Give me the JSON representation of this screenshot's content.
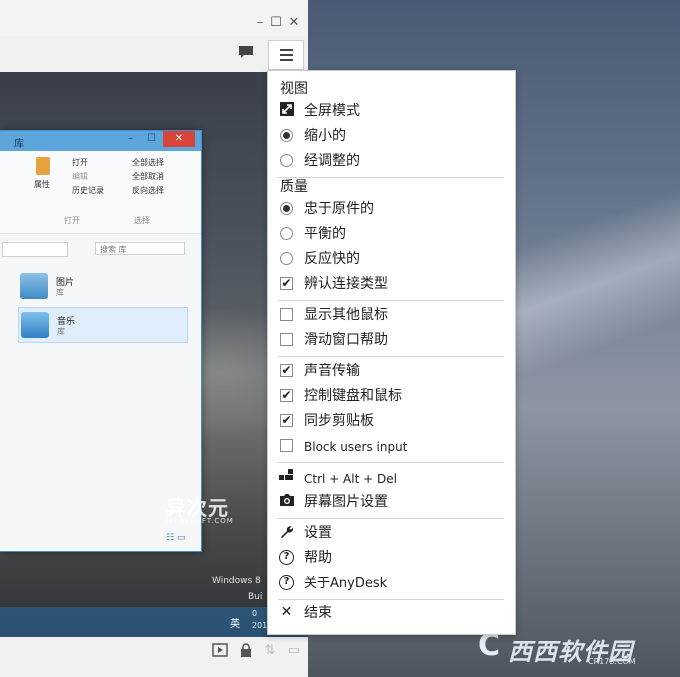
{
  "window": {
    "controls": [
      "–",
      "☐",
      "✕"
    ],
    "toolbar_icons": [
      "chat-icon"
    ]
  },
  "remote_desktop": {
    "explorer": {
      "title": "库",
      "ribbon": {
        "open": "打开",
        "edit": "编辑",
        "history": "历史记录",
        "properties": "属性",
        "select_all": "全部选择",
        "select_none": "全部取消",
        "invert_selection": "反向选择",
        "group_open": "打开",
        "group_select": "选择"
      },
      "search_placeholder": "搜索 库",
      "items": [
        {
          "name": "图片",
          "sub": "库"
        },
        {
          "name": "音乐",
          "sub": "库"
        }
      ]
    },
    "watermark": "异次元",
    "watermark_sub": "IPLAYSOFT.COM",
    "windows_text": "Windows 8",
    "build_text": "Bui",
    "taskbar": {
      "ime": "英",
      "time": "0",
      "date": "201"
    }
  },
  "menu": {
    "view_header": "视图",
    "view_items": [
      {
        "label": "全屏模式",
        "icon": "fullscreen-icon"
      },
      {
        "label": "缩小的",
        "selected": true
      },
      {
        "label": "经调整的",
        "selected": false
      }
    ],
    "quality_header": "质量",
    "quality_items": [
      {
        "label": "忠于原件的",
        "selected": true
      },
      {
        "label": "平衡的",
        "selected": false
      },
      {
        "label": "反应快的",
        "selected": false
      }
    ],
    "detect_connection": {
      "label": "辨认连接类型",
      "checked": true
    },
    "show_remote_cursor": {
      "label": "显示其他鼠标",
      "checked": false
    },
    "scroll_window_help": {
      "label": "滑动窗口帮助",
      "checked": false
    },
    "transmit_audio": {
      "label": "声音传输",
      "checked": true
    },
    "control_input": {
      "label": "控制键盘和鼠标",
      "checked": true
    },
    "sync_clipboard": {
      "label": "同步剪贴板",
      "checked": true
    },
    "block_input": {
      "label": "Block users input",
      "checked": false
    },
    "ctrl_alt_del": "Ctrl + Alt + Del",
    "screenshot_settings": "屏幕图片设置",
    "settings": "设置",
    "help": "帮助",
    "about": "关于AnyDesk",
    "end": "结束",
    "check_mark": "✔"
  },
  "branding": {
    "logo": "西西软件园",
    "logo_sub": "CR173.COM"
  }
}
